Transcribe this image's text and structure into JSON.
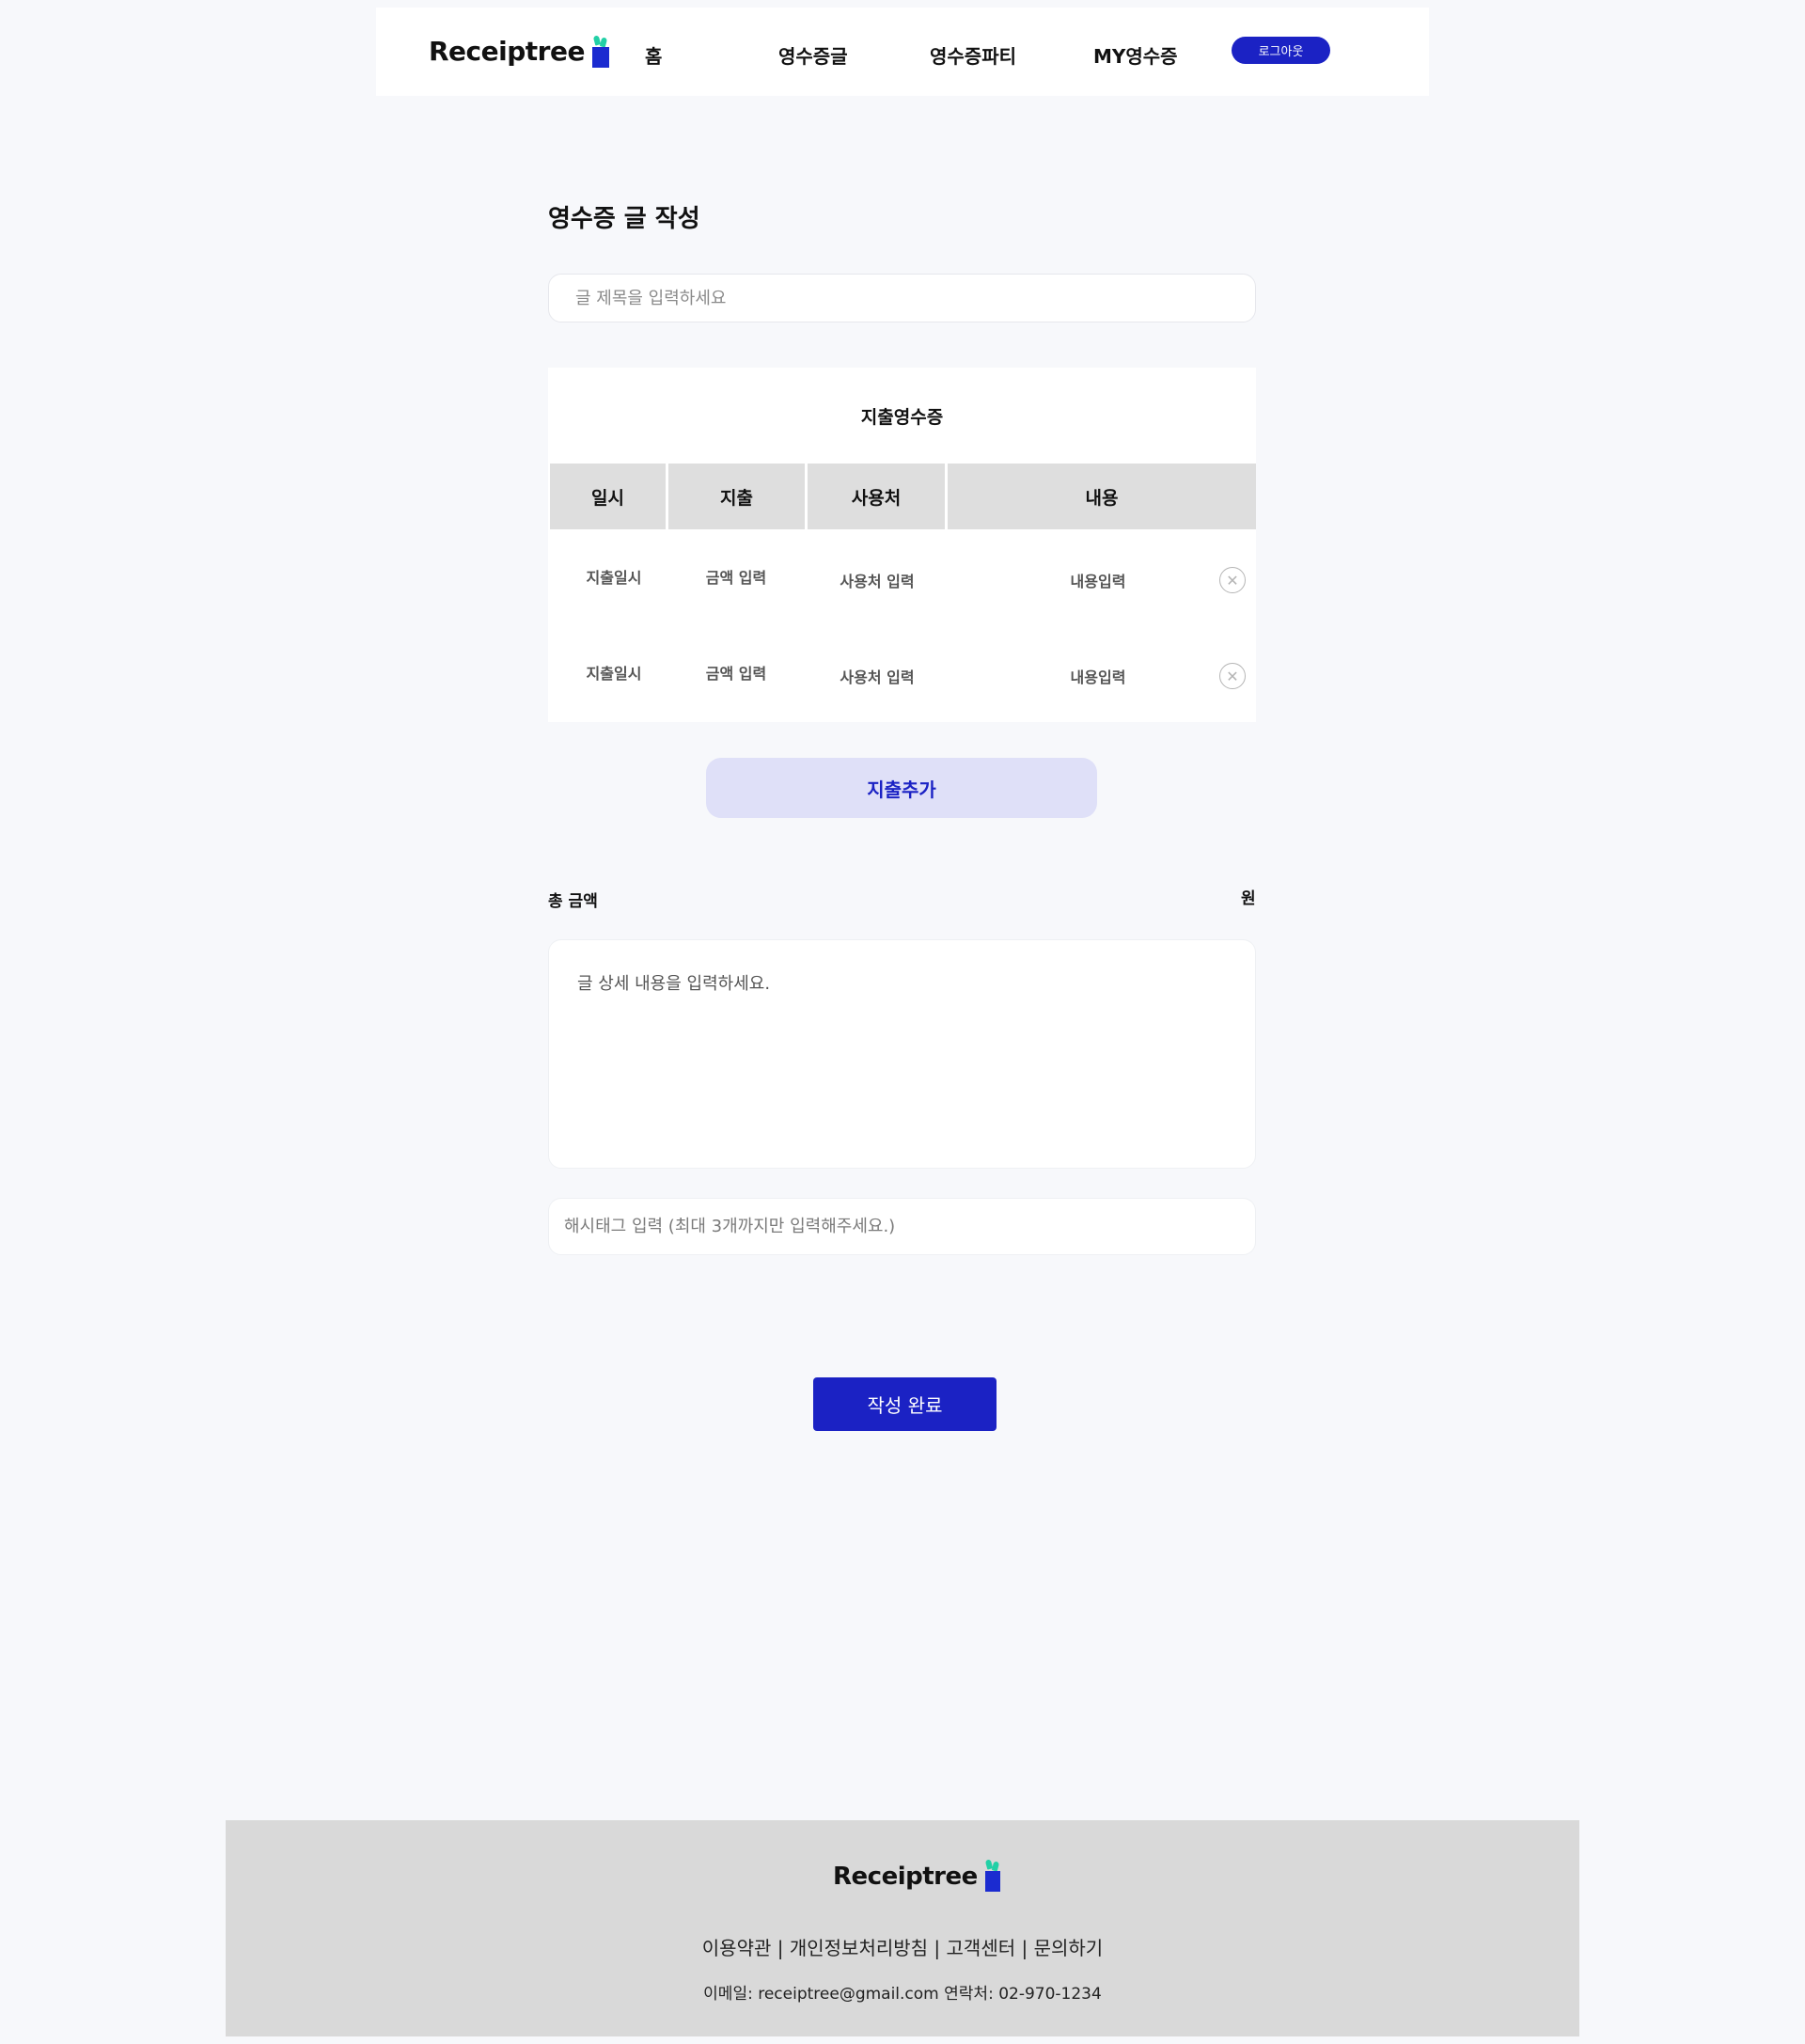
{
  "header": {
    "logo_text": "Receiptree",
    "nav": [
      "홈",
      "영수증글",
      "영수증파티",
      "MY영수증"
    ],
    "logout_label": "로그아웃"
  },
  "page_title": "영수증 글 작성",
  "title_input": {
    "placeholder": "글 제목을 입력하세요",
    "value": ""
  },
  "receipt": {
    "title": "지출영수증",
    "columns": [
      "일시",
      "지출",
      "사용처",
      "내용"
    ],
    "rows": [
      {
        "date_placeholder": "지출일시",
        "amount_placeholder": "금액 입력",
        "place_placeholder": "사용처 입력",
        "content_placeholder": "내용입력"
      },
      {
        "date_placeholder": "지출일시",
        "amount_placeholder": "금액 입력",
        "place_placeholder": "사용처 입력",
        "content_placeholder": "내용입력"
      }
    ],
    "remove_icon": "close-circle-icon"
  },
  "add_expense_label": "지출추가",
  "total": {
    "label": "총 금액",
    "unit": "원"
  },
  "detail_input": {
    "placeholder": "글 상세 내용을 입력하세요."
  },
  "hashtag_input": {
    "placeholder": "해시태그 입력 (최대 3개까지만 입력해주세요.)"
  },
  "submit_label": "작성 완료",
  "footer": {
    "logo_text": "Receiptree",
    "links": [
      "이용약관",
      "개인정보처리방침",
      "고객센터",
      "문의하기"
    ],
    "separator": "|",
    "contact": "이메일: receiptree@gmail.com 연락처: 02-970-1234"
  },
  "colors": {
    "primary": "#1b22c4",
    "primary_light": "#dfe0f8",
    "accent_leaf": "#22d0a6",
    "background": "#f7f8fb",
    "footer_bg": "#d9d9d9",
    "table_header_bg": "#dedede"
  }
}
